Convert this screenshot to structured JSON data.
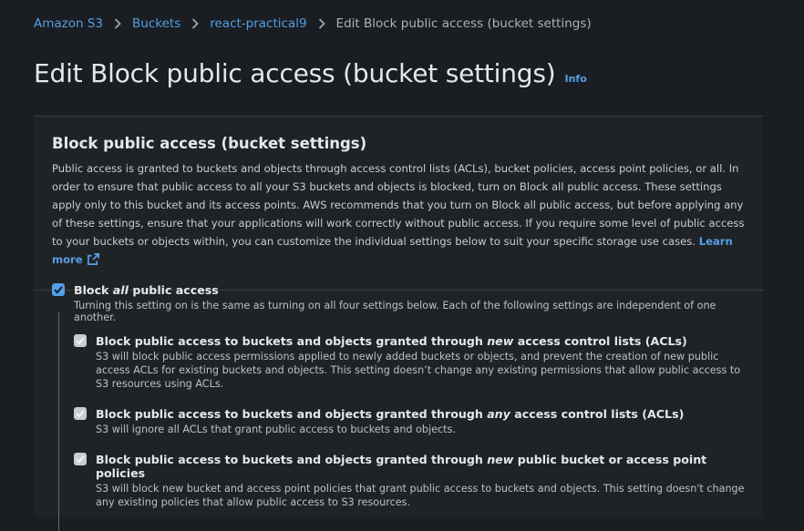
{
  "breadcrumb": {
    "items": [
      "Amazon S3",
      "Buckets",
      "react-practical9"
    ],
    "current": "Edit Block public access (bucket settings)"
  },
  "page": {
    "title": "Edit Block public access (bucket settings)",
    "info_label": "Info"
  },
  "panel": {
    "title": "Block public access (bucket settings)",
    "description": "Public access is granted to buckets and objects through access control lists (ACLs), bucket policies, access point policies, or all. In order to ensure that public access to all your S3 buckets and objects is blocked, turn on Block all public access. These settings apply only to this bucket and its access points. AWS recommends that you turn on Block all public access, but before applying any of these settings, ensure that your applications will work correctly without public access. If you require some level of public access to your buckets or objects within, you can customize the individual settings below to suit your specific storage use cases.",
    "learn_more": "Learn more"
  },
  "block_all": {
    "label_pre": "Block ",
    "label_em": "all",
    "label_post": " public access",
    "checked": true,
    "description": "Turning this setting on is the same as turning on all four settings below. Each of the following settings are independent of one another."
  },
  "options": [
    {
      "label_pre": "Block public access to buckets and objects granted through ",
      "label_em": "new",
      "label_post": " access control lists (ACLs)",
      "checked": true,
      "description": "S3 will block public access permissions applied to newly added buckets or objects, and prevent the creation of new public access ACLs for existing buckets and objects. This setting doesn’t change any existing permissions that allow public access to S3 resources using ACLs."
    },
    {
      "label_pre": "Block public access to buckets and objects granted through ",
      "label_em": "any",
      "label_post": " access control lists (ACLs)",
      "checked": true,
      "description": "S3 will ignore all ACLs that grant public access to buckets and objects."
    },
    {
      "label_pre": "Block public access to buckets and objects granted through ",
      "label_em": "new",
      "label_post": " public bucket or access point policies",
      "checked": true,
      "description": "S3 will block new bucket and access point policies that grant public access to buckets and objects. This setting doesn't change any existing policies that allow public access to S3 resources."
    }
  ],
  "colors": {
    "background": "#1a1d21",
    "panel": "#202326",
    "link": "#539fe5",
    "checkbox_primary": "#539fe5",
    "checkbox_disabled": "#c9ced4"
  }
}
